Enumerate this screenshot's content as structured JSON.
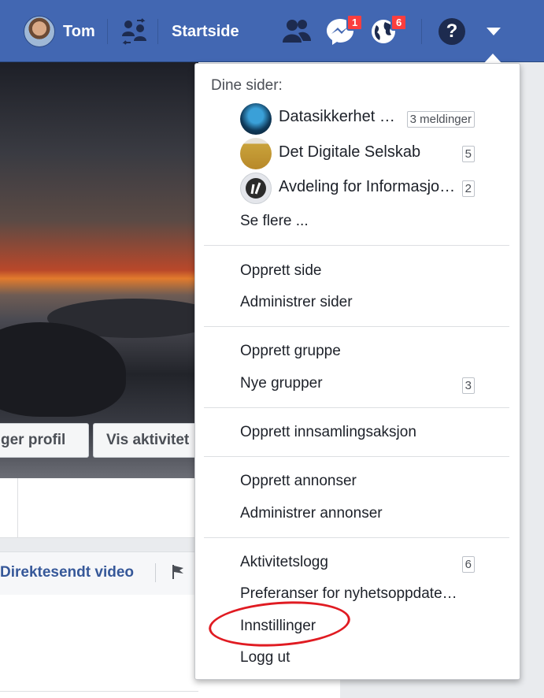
{
  "topbar": {
    "user_name": "Tom",
    "home_label": "Startside",
    "messenger_badge": "1",
    "notifications_badge": "6",
    "help_glyph": "?"
  },
  "cover": {
    "edit_profile_label": "ger profil",
    "activity_label": "Vis aktivitet"
  },
  "page_tabs": {
    "live_video": "Direktesendt video"
  },
  "dropdown": {
    "pages_header": "Dine sider:",
    "pages": [
      {
        "name": "Datasikkerhet …",
        "count": "3 meldinger"
      },
      {
        "name": "Det Digitale Selskab",
        "count": "5"
      },
      {
        "name": "Avdeling for Informasjo…",
        "count": "2"
      }
    ],
    "see_more": "Se flere ...",
    "create_page": "Opprett side",
    "manage_pages": "Administrer sider",
    "create_group": "Opprett gruppe",
    "new_groups": "Nye grupper",
    "new_groups_count": "3",
    "create_fundraiser": "Opprett innsamlingsaksjon",
    "create_ads": "Opprett annonser",
    "manage_ads": "Administrer annonser",
    "activity_log": "Aktivitetslogg",
    "activity_log_count": "6",
    "news_feed_prefs": "Preferanser for nyhetsoppdate…",
    "settings": "Innstillinger",
    "log_out": "Logg ut"
  },
  "colors": {
    "topbar_bg": "#4267b2",
    "badge_red": "#fa3e3e",
    "highlight_circle": "#e01b22",
    "link_blue": "#365899"
  },
  "icons": [
    "friends-icon",
    "messenger-icon",
    "globe-notifications-icon",
    "help-icon",
    "dropdown-caret-icon",
    "find-friends-icon",
    "flag-icon"
  ]
}
